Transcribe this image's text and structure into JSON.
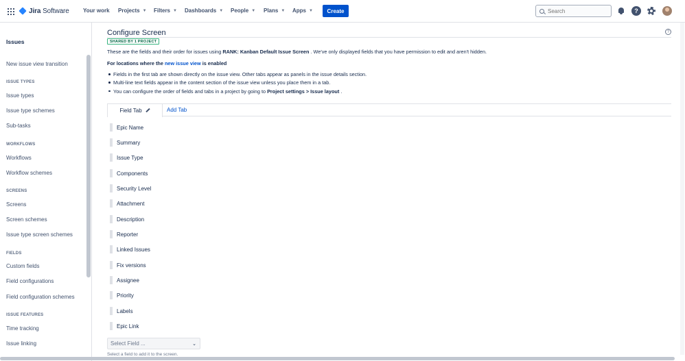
{
  "topnav": {
    "product_name_bold": "Jira",
    "product_name_light": " Software",
    "items": [
      {
        "label": "Your work",
        "dropdown": false
      },
      {
        "label": "Projects",
        "dropdown": true
      },
      {
        "label": "Filters",
        "dropdown": true
      },
      {
        "label": "Dashboards",
        "dropdown": true
      },
      {
        "label": "People",
        "dropdown": true
      },
      {
        "label": "Plans",
        "dropdown": true
      },
      {
        "label": "Apps",
        "dropdown": true
      }
    ],
    "create_label": "Create",
    "search_placeholder": "Search",
    "icons": [
      "app-switcher-icon",
      "notifications-icon",
      "help-icon",
      "settings-icon",
      "avatar"
    ],
    "brand_color": "#0052cc"
  },
  "sidebar": {
    "title": "Issues",
    "link_transition": "New issue view transition",
    "sections": [
      {
        "heading": "ISSUE TYPES",
        "items": [
          "Issue types",
          "Issue type schemes",
          "Sub-tasks"
        ]
      },
      {
        "heading": "WORKFLOWS",
        "items": [
          "Workflows",
          "Workflow schemes"
        ]
      },
      {
        "heading": "SCREENS",
        "items": [
          "Screens",
          "Screen schemes",
          "Issue type screen schemes"
        ]
      },
      {
        "heading": "FIELDS",
        "items": [
          "Custom fields",
          "Field configurations",
          "Field configuration schemes"
        ]
      },
      {
        "heading": "ISSUE FEATURES",
        "items": [
          "Time tracking",
          "Issue linking"
        ]
      }
    ]
  },
  "main": {
    "title": "Configure Screen",
    "shared_badge": "SHARED BY 1 PROJECT",
    "intro_prefix": "These are the fields and their order for issues using ",
    "intro_screen": "RANK: Kanban Default Issue Screen",
    "intro_suffix": " . We've only displayed fields that you have permission to edit and aren't hidden.",
    "locations_prefix": "For locations where the ",
    "locations_link": "new issue view",
    "locations_suffix": " is enabled",
    "bullets": {
      "b1": "Fields in the first tab are shown directly on the issue view. Other tabs appear as panels in the issue details section.",
      "b2": "Multi-line text fields appear in the content section of the issue view unless you place them in a tab.",
      "b3_prefix": "You can configure the order of fields and tabs in a project by going to ",
      "b3_bold": "Project settings > Issue layout",
      "b3_suffix": " ."
    },
    "tabs": {
      "active": "Field Tab",
      "add": "Add Tab"
    },
    "fields": [
      "Epic Name",
      "Summary",
      "Issue Type",
      "Components",
      "Security Level",
      "Attachment",
      "Description",
      "Reporter",
      "Linked Issues",
      "Fix versions",
      "Assignee",
      "Priority",
      "Labels",
      "Epic Link"
    ],
    "select_placeholder": "Select Field ...",
    "select_hint": "Select a field to add it to the screen."
  }
}
